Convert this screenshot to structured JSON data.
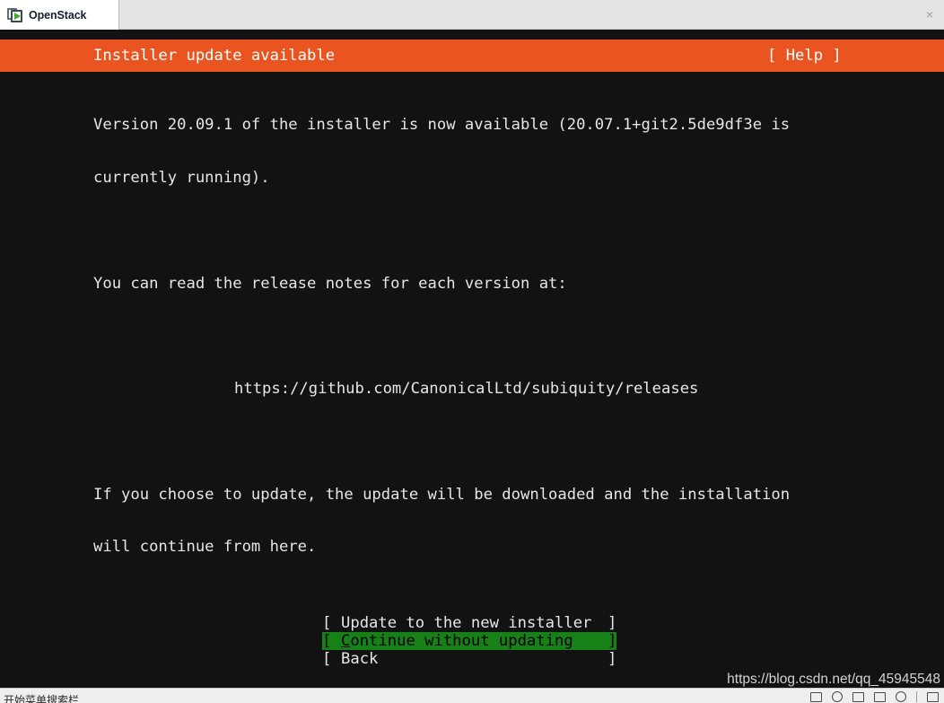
{
  "window": {
    "tab": {
      "title": "OpenStack",
      "close_label": "×",
      "icon": "vm-console-icon"
    }
  },
  "installer": {
    "header": {
      "title": "Installer update available",
      "help_label": "[ Help ]"
    },
    "body": {
      "line1": "Version 20.09.1 of the installer is now available (20.07.1+git2.5de9df3e is",
      "line2": "currently running).",
      "line3": "You can read the release notes for each version at:",
      "url": "https://github.com/CanonicalLtd/subiquity/releases",
      "line4": "If you choose to update, the update will be downloaded and the installation",
      "line5": "will continue from here."
    },
    "menu": {
      "bracket_left": "[",
      "bracket_right": "]",
      "items": [
        {
          "label": "Update to the new installer",
          "selected": false,
          "accel": "",
          "rest": "Update to the new installer"
        },
        {
          "label": "Continue without updating",
          "selected": true,
          "accel": "C",
          "rest": "ontinue without updating"
        },
        {
          "label": "Back",
          "selected": false,
          "accel": "",
          "rest": "Back"
        }
      ]
    },
    "colors": {
      "header_orange": "#e95420",
      "selection_green": "#178017",
      "terminal_background": "#121212",
      "terminal_foreground": "#e6e6e6"
    }
  },
  "watermark": {
    "text": "https://blog.csdn.net/qq_45945548"
  },
  "taskbar": {
    "text": "开始菜单搜索栏",
    "icons": [
      "window-icon",
      "clock-icon",
      "app-icon",
      "tray-icon",
      "network-icon",
      "panel-icon"
    ]
  }
}
